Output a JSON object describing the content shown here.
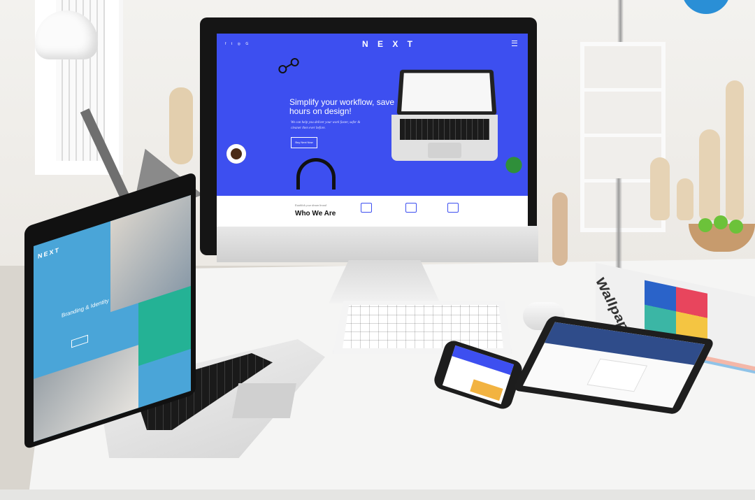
{
  "imac": {
    "logo": "N E X T",
    "hero": {
      "title": "Simplify your workflow, save hours on design!",
      "subtitle": "We can help you deliver your work faster, safer & cleaner then ever before.",
      "button": "Buy Next Now"
    },
    "about": {
      "eyebrow": "Establish your dream brand",
      "title": "Who We Are"
    },
    "social_icons": [
      "facebook-icon",
      "twitter-icon",
      "instagram-icon",
      "google-icon"
    ],
    "accent_color": "#3d4ff0"
  },
  "laptop": {
    "logo": "NEXT",
    "hero_title": "Branding & Identity",
    "accent_color": "#24b295"
  },
  "magazine": {
    "title": "Wallpaper*"
  }
}
